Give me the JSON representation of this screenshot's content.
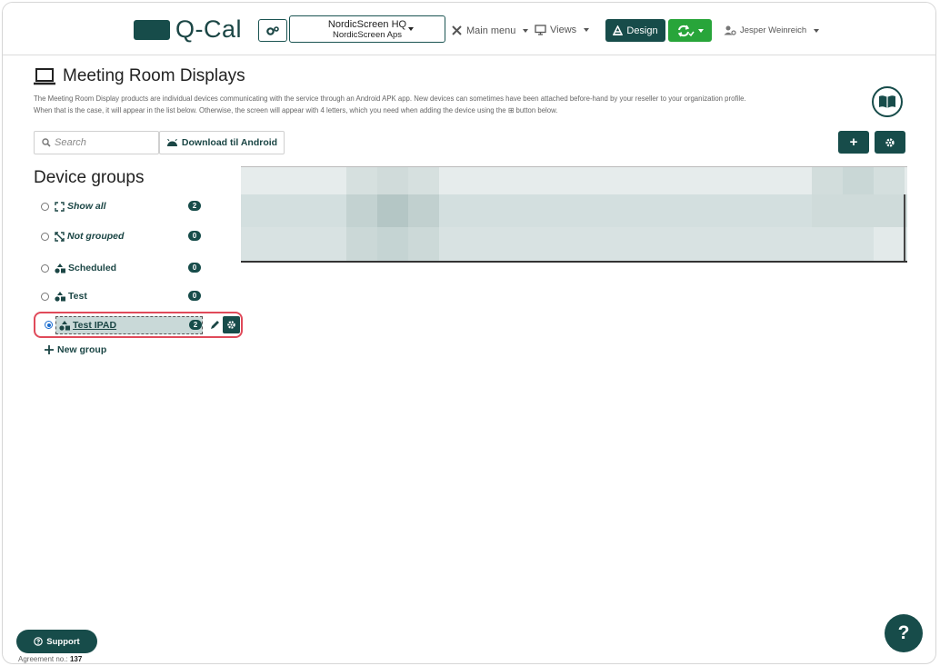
{
  "app": {
    "logo_text": "Q-Cal"
  },
  "topbar": {
    "org_name": "NordicScreen HQ",
    "org_sub": "NordicScreen Aps",
    "main_menu": "Main menu",
    "views": "Views",
    "design": "Design",
    "user": "Jesper Weinreich"
  },
  "page": {
    "title": "Meeting Room Displays",
    "desc_line1": "The Meeting Room Display products are individual devices communicating with the service through an Android APK app. New devices can sometimes have been attached before-hand by your reseller to your organization profile.",
    "desc_line2": "When that is the case, it will appear in the list below. Otherwise, the screen will appear with 4 letters, which you need when adding the device using the ⊞ button below."
  },
  "toolbar": {
    "search_placeholder": "Search",
    "download_label": "Download til Android",
    "add_label": "+"
  },
  "groups": {
    "title": "Device groups",
    "items": [
      {
        "label": "Show all",
        "count": "2",
        "italic": true
      },
      {
        "label": "Not grouped",
        "count": "0",
        "italic": true
      },
      {
        "label": "Scheduled",
        "count": "0",
        "italic": false
      },
      {
        "label": "Test",
        "count": "0",
        "italic": false
      },
      {
        "label": "Test IPAD",
        "count": "2",
        "italic": false,
        "selected": true
      }
    ],
    "new_group": "New group"
  },
  "footer": {
    "support": "Support",
    "agreement_label": "Agreement no.:",
    "agreement_no": "137",
    "help": "?"
  },
  "colors": {
    "primary": "#174c4a",
    "sync": "#28a53a",
    "highlight": "#e04a5a"
  }
}
